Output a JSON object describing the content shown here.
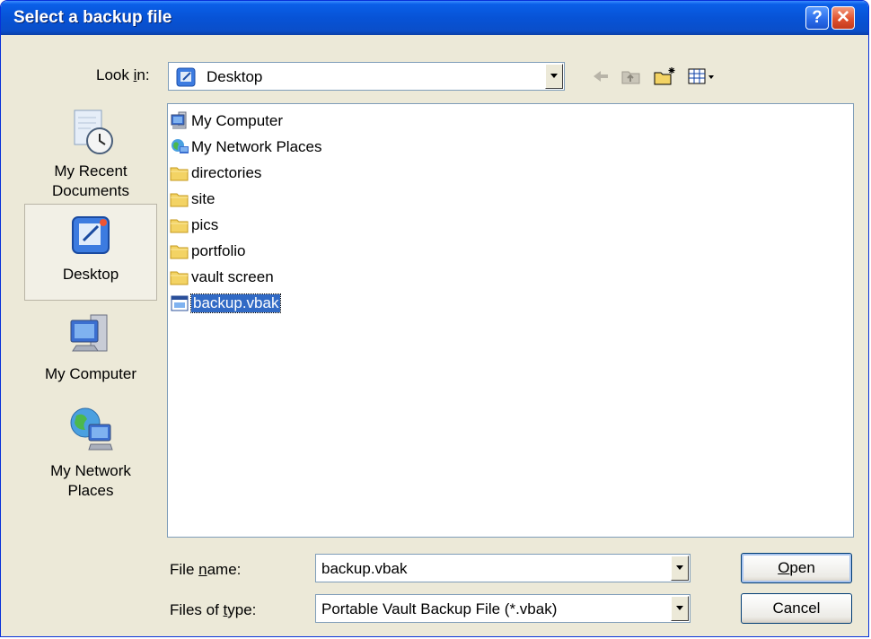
{
  "window": {
    "title": "Select a backup file",
    "help_glyph": "?",
    "close_glyph": "✕"
  },
  "lookin": {
    "label_pre": "Look ",
    "label_mnemonic": "i",
    "label_post": "n:",
    "value": "Desktop"
  },
  "toolbar": {
    "icons": [
      "back-arrow-icon",
      "up-folder-icon",
      "new-folder-icon",
      "view-menu-icon"
    ]
  },
  "places": [
    {
      "label_lines": [
        "My Recent",
        "Documents"
      ],
      "icon": "recent-documents-icon",
      "selected": false
    },
    {
      "label_lines": [
        "Desktop"
      ],
      "icon": "desktop-icon",
      "selected": true
    },
    {
      "label_lines": [
        "My Computer"
      ],
      "icon": "my-computer-icon",
      "selected": false
    },
    {
      "label_lines": [
        "My Network",
        "Places"
      ],
      "icon": "network-places-icon",
      "selected": false
    }
  ],
  "files": [
    {
      "name": "My Computer",
      "icon": "my-computer-icon"
    },
    {
      "name": "My Network Places",
      "icon": "network-places-icon"
    },
    {
      "name": "directories",
      "icon": "folder-icon"
    },
    {
      "name": "site",
      "icon": "folder-icon"
    },
    {
      "name": "pics",
      "icon": "folder-icon"
    },
    {
      "name": "portfolio",
      "icon": "folder-icon"
    },
    {
      "name": "vault screen",
      "icon": "folder-icon"
    },
    {
      "name": "backup.vbak",
      "icon": "backup-file-icon",
      "selected": true
    }
  ],
  "filename": {
    "label_pre": "File ",
    "label_mnemonic": "n",
    "label_post": "ame:",
    "value": "backup.vbak"
  },
  "filetype": {
    "label_pre": "Files of ",
    "label_mnemonic": "t",
    "label_post": "ype:",
    "value": "Portable Vault Backup File (*.vbak)"
  },
  "buttons": {
    "open_mnemonic": "O",
    "open_rest": "pen",
    "cancel": "Cancel"
  },
  "colors": {
    "title_blue": "#0a5fe8",
    "selection": "#316ac5",
    "face": "#ece9d8"
  }
}
